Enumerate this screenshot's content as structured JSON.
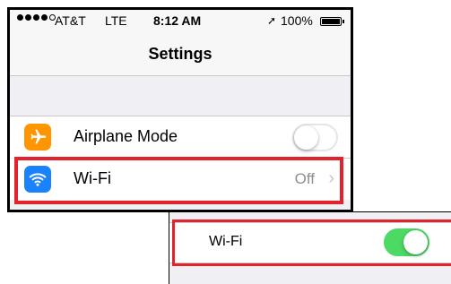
{
  "status_bar": {
    "carrier": "AT&T",
    "network": "LTE",
    "time": "8:12 AM",
    "battery": "100%",
    "signal_bars": 4,
    "signal_max": 5
  },
  "nav": {
    "title": "Settings"
  },
  "settings_rows": {
    "airplane": {
      "label": "Airplane Mode",
      "toggle_on": false,
      "icon": "airplane-icon",
      "icon_color": "#ff9500"
    },
    "wifi": {
      "label": "Wi-Fi",
      "value": "Off",
      "icon": "wifi-icon",
      "icon_color": "#1a82fb"
    }
  },
  "zoom_snippet": {
    "label": "Wi-Fi",
    "toggle_on": true
  },
  "colors": {
    "highlight": "#e2232b",
    "toggle_on": "#4cd964"
  }
}
